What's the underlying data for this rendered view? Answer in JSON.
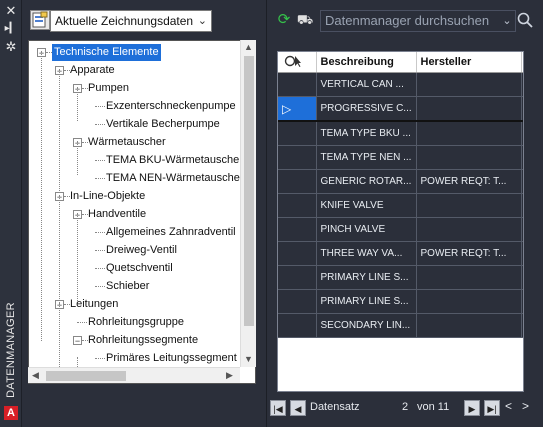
{
  "palette": {
    "title": "DATENMANAGER"
  },
  "view_selector": {
    "value": "Aktuelle Zeichnungsdaten"
  },
  "tree": {
    "nodes": [
      {
        "label": "Technische Elemente",
        "depth": 0,
        "expander": "−",
        "selected": true
      },
      {
        "label": "Apparate",
        "depth": 1,
        "expander": "−"
      },
      {
        "label": "Pumpen",
        "depth": 2,
        "expander": "−"
      },
      {
        "label": "Exzenterschneckenpumpe",
        "depth": 3,
        "expander": ""
      },
      {
        "label": "Vertikale Becherpumpe",
        "depth": 3,
        "expander": ""
      },
      {
        "label": "Wärmetauscher",
        "depth": 2,
        "expander": "−"
      },
      {
        "label": "TEMA BKU-Wärmetauscher",
        "depth": 3,
        "expander": ""
      },
      {
        "label": "TEMA NEN-Wärmetauscher",
        "depth": 3,
        "expander": ""
      },
      {
        "label": "In-Line-Objekte",
        "depth": 1,
        "expander": "−"
      },
      {
        "label": "Handventile",
        "depth": 2,
        "expander": "−"
      },
      {
        "label": "Allgemeines Zahnradventil",
        "depth": 3,
        "expander": ""
      },
      {
        "label": "Dreiweg-Ventil",
        "depth": 3,
        "expander": ""
      },
      {
        "label": "Quetschventil",
        "depth": 3,
        "expander": ""
      },
      {
        "label": "Schieber",
        "depth": 3,
        "expander": ""
      },
      {
        "label": "Leitungen",
        "depth": 1,
        "expander": "−"
      },
      {
        "label": "Rohrleitungsgruppe",
        "depth": 2,
        "expander": ""
      },
      {
        "label": "Rohrleitungssegmente",
        "depth": 2,
        "expander": "−"
      },
      {
        "label": "Primäres Leitungssegment",
        "depth": 3,
        "expander": ""
      }
    ]
  },
  "toolbar": {
    "refresh_icon": "refresh-icon",
    "zoom_icon": "zoom-to-item-icon",
    "search_placeholder": "Datenmanager durchsuchen"
  },
  "grid": {
    "columns": [
      "Beschreibung",
      "Hersteller"
    ],
    "current_row": 1,
    "rows": [
      {
        "beschreibung": "VERTICAL CAN ...",
        "hersteller": ""
      },
      {
        "beschreibung": "PROGRESSIVE C...",
        "hersteller": ""
      },
      {
        "beschreibung": "TEMA TYPE BKU ...",
        "hersteller": ""
      },
      {
        "beschreibung": "TEMA TYPE NEN ...",
        "hersteller": ""
      },
      {
        "beschreibung": "GENERIC ROTAR...",
        "hersteller": "POWER REQT: T..."
      },
      {
        "beschreibung": "KNIFE VALVE",
        "hersteller": ""
      },
      {
        "beschreibung": "PINCH VALVE",
        "hersteller": ""
      },
      {
        "beschreibung": "THREE WAY VA...",
        "hersteller": "POWER REQT: T..."
      },
      {
        "beschreibung": "PRIMARY LINE S...",
        "hersteller": ""
      },
      {
        "beschreibung": "PRIMARY LINE S...",
        "hersteller": ""
      },
      {
        "beschreibung": "SECONDARY LIN...",
        "hersteller": ""
      }
    ]
  },
  "nav": {
    "label": "Datensatz",
    "current": "2",
    "of_label": "von 11"
  }
}
